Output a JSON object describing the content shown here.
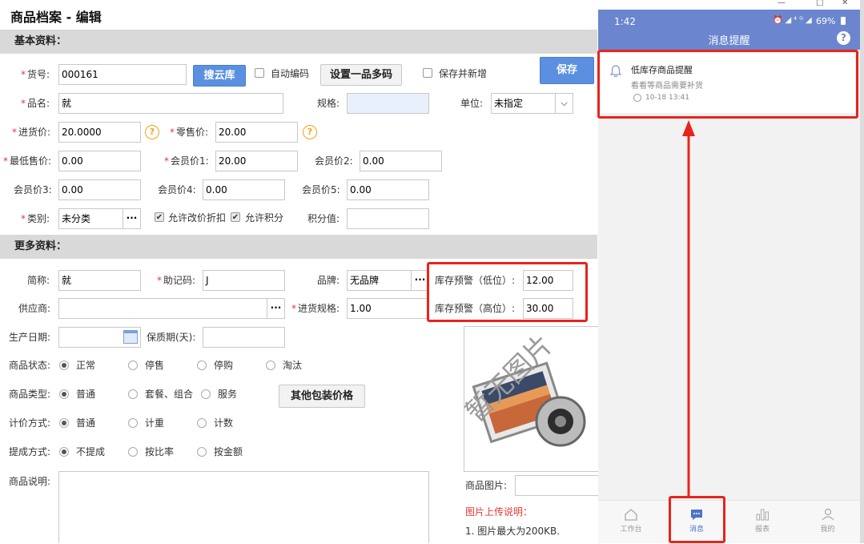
{
  "form": {
    "title": "商品档案 - 编辑",
    "section_basic": "基本资料：",
    "section_more": "更多资料：",
    "required_mark": "*",
    "sku": {
      "label": "货号:",
      "value": "000161"
    },
    "search_cloud_button": "搜云库",
    "auto_code_label": "自动编码",
    "multi_code_button": "设置一品多码",
    "save_and_add_label": "保存并新增",
    "save_button": "保存",
    "name": {
      "label": "品名:",
      "value": "就"
    },
    "spec": {
      "label": "规格:",
      "value": ""
    },
    "unit": {
      "label": "单位:",
      "value": "未指定"
    },
    "purchase_price": {
      "label": "进货价:",
      "value": "20.0000"
    },
    "retail_price": {
      "label": "零售价:",
      "value": "20.00"
    },
    "min_price": {
      "label": "最低售价:",
      "value": "0.00"
    },
    "member_price1": {
      "label": "会员价1:",
      "value": "20.00"
    },
    "member_price2": {
      "label": "会员价2:",
      "value": "0.00"
    },
    "member_price3": {
      "label": "会员价3:",
      "value": "0.00"
    },
    "member_price4": {
      "label": "会员价4:",
      "value": "0.00"
    },
    "member_price5": {
      "label": "会员价5:",
      "value": "0.00"
    },
    "category": {
      "label": "类别:",
      "value": "未分类"
    },
    "allow_discount_label": "允许改价折扣",
    "allow_points_label": "允许积分",
    "points": {
      "label": "积分值:",
      "value": ""
    },
    "abbr": {
      "label": "简称:",
      "value": "就"
    },
    "mnemonic": {
      "label": "助记码:",
      "value": "J"
    },
    "brand": {
      "label": "品牌:",
      "value": "无品牌"
    },
    "stock_low": {
      "label": "库存预警（低位）:",
      "value": "12.00"
    },
    "stock_high": {
      "label": "库存预警（高位）:",
      "value": "30.00"
    },
    "supplier": {
      "label": "供应商:",
      "value": ""
    },
    "purchase_spec": {
      "label": "进货规格:",
      "value": "1.00"
    },
    "production_date": {
      "label": "生产日期:",
      "value": ""
    },
    "shelf_life": {
      "label": "保质期(天):",
      "value": ""
    },
    "status": {
      "label": "商品状态:",
      "options": [
        "正常",
        "停售",
        "停购",
        "淘汰"
      ]
    },
    "type": {
      "label": "商品类型:",
      "options": [
        "普通",
        "套餐、组合",
        "服务"
      ]
    },
    "other_pack_button": "其他包装价格",
    "pricing": {
      "label": "计价方式:",
      "options": [
        "普通",
        "计重",
        "计数"
      ]
    },
    "commission": {
      "label": "提成方式:",
      "options": [
        "不提成",
        "按比率",
        "按金额"
      ]
    },
    "desc_label": "商品说明:",
    "image_placeholder_text": "暂无图片",
    "image_label": "商品图片:",
    "upload_title": "图片上传说明：",
    "upload_note1": "1. 图片最大为200KB."
  },
  "phone": {
    "time": "1:42",
    "battery": "69%",
    "header_title": "消息提醒",
    "notification": {
      "title": "低库存商品提醒",
      "subtitle": "看看等商品需要补货",
      "time": "10-18 13:41"
    },
    "tabs": [
      {
        "label": "工作台",
        "icon": "home-icon"
      },
      {
        "label": "消息",
        "icon": "message-icon"
      },
      {
        "label": "报表",
        "icon": "chart-icon"
      },
      {
        "label": "我的",
        "icon": "user-icon"
      }
    ]
  },
  "colors": {
    "accent": "#5b8fe0",
    "phone_header": "#6b86cf",
    "annotation_red": "#e8241b",
    "warning": "#f2a31b"
  }
}
